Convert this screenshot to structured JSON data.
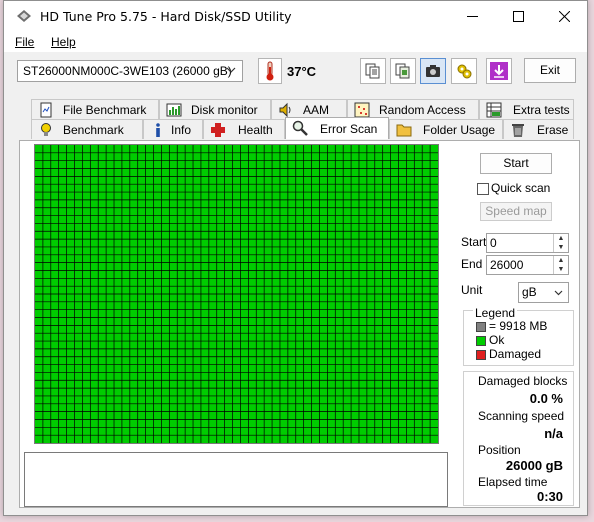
{
  "window": {
    "title": "HD Tune Pro 5.75 - Hard Disk/SSD Utility"
  },
  "menu": {
    "file": "File",
    "help": "Help"
  },
  "toolbar": {
    "drive": "ST26000NM000C-3WE103 (26000 gB)",
    "temperature": "37°C",
    "exit_label": "Exit",
    "icons": [
      "copy-text-icon",
      "copy-screenshot-icon",
      "camera-icon",
      "options-icon",
      "save-icon"
    ]
  },
  "tabs": {
    "row1": [
      "File Benchmark",
      "Disk monitor",
      "AAM",
      "Random Access",
      "Extra tests"
    ],
    "row2": [
      "Benchmark",
      "Info",
      "Health",
      "Error Scan",
      "Folder Usage",
      "Erase"
    ],
    "active": "Error Scan"
  },
  "scan": {
    "start_button": "Start",
    "quick_scan_label": "Quick scan",
    "quick_scan_checked": false,
    "speed_map_button": "Speed map",
    "start_label": "Start",
    "start_value": "0",
    "end_label": "End",
    "end_value": "26000",
    "unit_label": "Unit",
    "unit_value": "gB"
  },
  "legend": {
    "title": "Legend",
    "block_size": "= 9918 MB",
    "ok": "Ok",
    "damaged": "Damaged"
  },
  "stats": {
    "damaged_blocks_label": "Damaged blocks",
    "damaged_blocks_value": "0.0 %",
    "scanning_speed_label": "Scanning speed",
    "scanning_speed_value": "n/a",
    "position_label": "Position",
    "position_value": "26000 gB",
    "elapsed_label": "Elapsed time",
    "elapsed_value": "0:30"
  },
  "colors": {
    "ok_block": "#00cc00",
    "damaged_block": "#e02020",
    "grid_line": "#000000"
  }
}
